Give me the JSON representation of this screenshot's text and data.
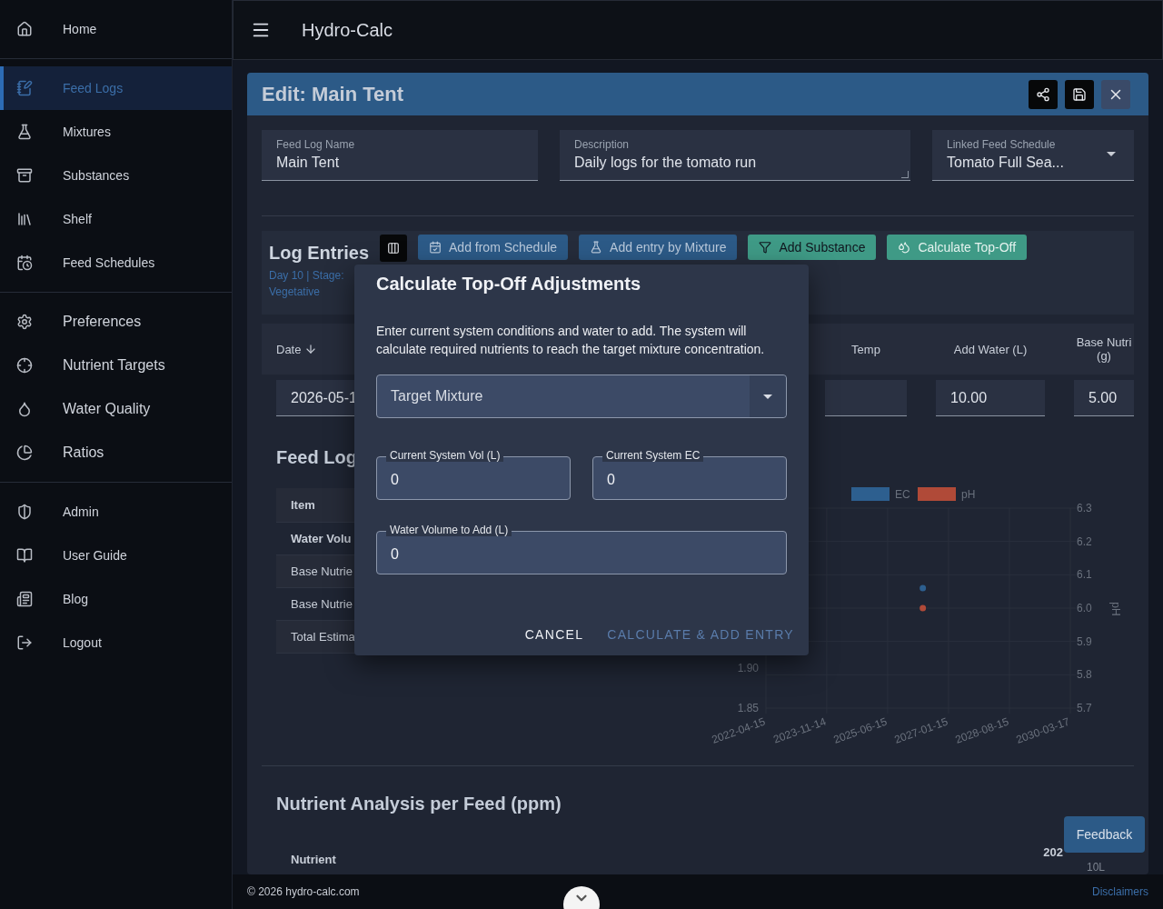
{
  "sidebar": {
    "sections": [
      {
        "items": [
          {
            "label": "Home",
            "selected": false
          }
        ]
      },
      {
        "items": [
          {
            "label": "Feed Logs",
            "selected": true
          },
          {
            "label": "Mixtures",
            "selected": false
          },
          {
            "label": "Substances",
            "selected": false
          },
          {
            "label": "Shelf",
            "selected": false
          },
          {
            "label": "Feed Schedules",
            "selected": false
          }
        ]
      },
      {
        "items": [
          {
            "label": "Preferences",
            "selected": false
          },
          {
            "label": "Nutrient Targets",
            "selected": false
          },
          {
            "label": "Water Quality",
            "selected": false
          },
          {
            "label": "Ratios",
            "selected": false
          }
        ]
      },
      {
        "items": [
          {
            "label": "Admin",
            "selected": false
          },
          {
            "label": "User Guide",
            "selected": false
          },
          {
            "label": "Blog",
            "selected": false
          },
          {
            "label": "Logout",
            "selected": false
          }
        ]
      }
    ]
  },
  "top_bar": {
    "title": "Hydro-Calc"
  },
  "editor": {
    "title": "Edit: Main Tent",
    "fields": [
      {
        "kind": "text",
        "label": "Feed Log Name",
        "value": "Main Tent"
      },
      {
        "kind": "textarea",
        "label": "Description",
        "value": "Daily logs for the tomato run"
      },
      {
        "kind": "select",
        "label": "Linked Feed Schedule",
        "value": "Tomato Full Sea..."
      }
    ],
    "log_entries": {
      "title": "Log Entries",
      "subtitle": "Day 10 | Stage: Vegetative",
      "buttons": [
        {
          "label": "Add from Schedule",
          "kind": "primary"
        },
        {
          "label": "Add entry by Mixture",
          "kind": "primary"
        },
        {
          "label": "Add Substance",
          "kind": "accent"
        },
        {
          "label": "Calculate Top-Off",
          "kind": "accent-light"
        }
      ],
      "columns": [
        {
          "label": "Date",
          "sorted": true
        },
        {
          "label": "Temp",
          "sorted": false
        },
        {
          "label": "Add Water (L)",
          "sorted": false
        },
        {
          "label": "Base Nutri (g)",
          "sorted": false
        }
      ],
      "row": [
        {
          "kind": "input",
          "value": "2026-05-1"
        },
        {
          "kind": "input"
        },
        {
          "kind": "input",
          "value": "10.00"
        },
        {
          "kind": "input",
          "value": "5.00"
        }
      ]
    },
    "feed_log": {
      "title": "Feed Log",
      "columns": [
        "Item"
      ],
      "rows": [
        {
          "label": "Water Volu",
          "emphasis": true
        },
        {
          "label": "Base Nutrie",
          "emphasis": false
        },
        {
          "label": "Base Nutrie",
          "emphasis": false
        },
        {
          "label": "Total Estima",
          "emphasis": false
        }
      ],
      "chart_data": {
        "type": "scatter",
        "x": [
          "2026-05-15"
        ],
        "series": [
          {
            "name": "EC",
            "color": "#2d5f8f",
            "values": [
              2.0
            ]
          },
          {
            "name": "pH",
            "color": "#b04a38",
            "values": [
              6.0
            ],
            "axis": "y2"
          }
        ],
        "xlim": [
          "2022-04-15",
          "2030-03-17"
        ],
        "grid": true,
        "legend": "top",
        "xticks": [
          {
            "value": "2022-04-15",
            "label": "2022-04-15"
          },
          {
            "value": "2023-11-14",
            "label": "2023-11-14"
          },
          {
            "value": "2025-06-15",
            "label": "2025-06-15"
          },
          {
            "value": "2027-01-15",
            "label": "2027-01-15"
          },
          {
            "value": "2028-08-15",
            "label": "2028-08-15"
          },
          {
            "value": "2030-03-17",
            "label": "2030-03-17"
          }
        ],
        "ylim": [
          1.85,
          2.1
        ],
        "yticks": [
          {
            "value": 1.85,
            "label": "1.85"
          },
          {
            "value": 1.9,
            "label": "1.90"
          }
        ],
        "y2lim": [
          5.7,
          6.3
        ],
        "y2label": "pH",
        "y2ticks": [
          {
            "value": 6.3,
            "label": "6.3"
          },
          {
            "value": 6.2,
            "label": "6.2"
          },
          {
            "value": 6.1,
            "label": "6.1"
          },
          {
            "value": 6.0,
            "label": "6.0"
          },
          {
            "value": 5.9,
            "label": "5.9"
          },
          {
            "value": 5.8,
            "label": "5.8"
          },
          {
            "value": 5.7,
            "label": "5.7"
          }
        ]
      }
    },
    "nutrient_analysis": {
      "title": "Nutrient Analysis per Feed (ppm)",
      "columns": [
        {
          "label": "Nutrient"
        },
        {
          "label": "202",
          "sublabel": "10L"
        }
      ]
    }
  },
  "modal": {
    "title": "Calculate Top-Off Adjustments",
    "text": "Enter current system conditions and water to add. The system will calculate required nutrients to reach the target mixture concentration.",
    "select": {
      "placeholder": "Target Mixture"
    },
    "fields": [
      {
        "label": "Current System Vol (L)",
        "value": "0"
      },
      {
        "label": "Current System EC",
        "value": "0"
      },
      {
        "label": "Water Volume to Add (L)",
        "value": "0"
      }
    ],
    "actions": [
      {
        "label": "CANCEL",
        "disabled": false
      },
      {
        "label": "CALCULATE & ADD ENTRY",
        "disabled": true
      }
    ]
  },
  "footer": {
    "copyright": "© 2026 hydro-calc.com",
    "link": "Disclaimers"
  },
  "feedback": {
    "label": "Feedback"
  }
}
